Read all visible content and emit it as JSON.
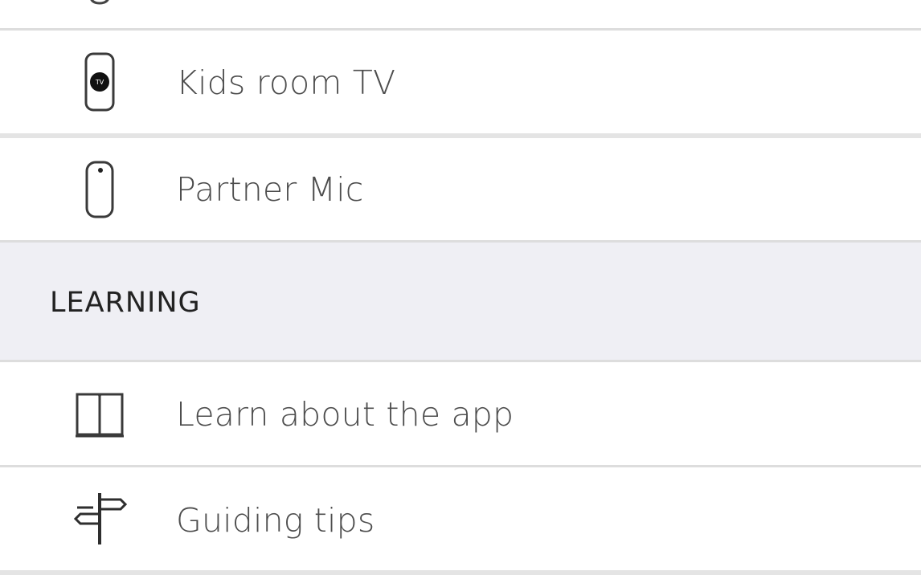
{
  "devices": {
    "items": [
      {
        "label": "Kids room TV",
        "icon": "tv-remote-icon"
      },
      {
        "label": "Partner Mic",
        "icon": "partner-mic-icon"
      }
    ]
  },
  "learning": {
    "header": "LEARNING",
    "items": [
      {
        "label": "Learn about the app",
        "icon": "open-book-icon"
      },
      {
        "label": "Guiding tips",
        "icon": "signpost-icon"
      }
    ]
  },
  "colors": {
    "section_background": "#efeff4",
    "divider": "#dddddd",
    "text": "#4d4d4d"
  }
}
